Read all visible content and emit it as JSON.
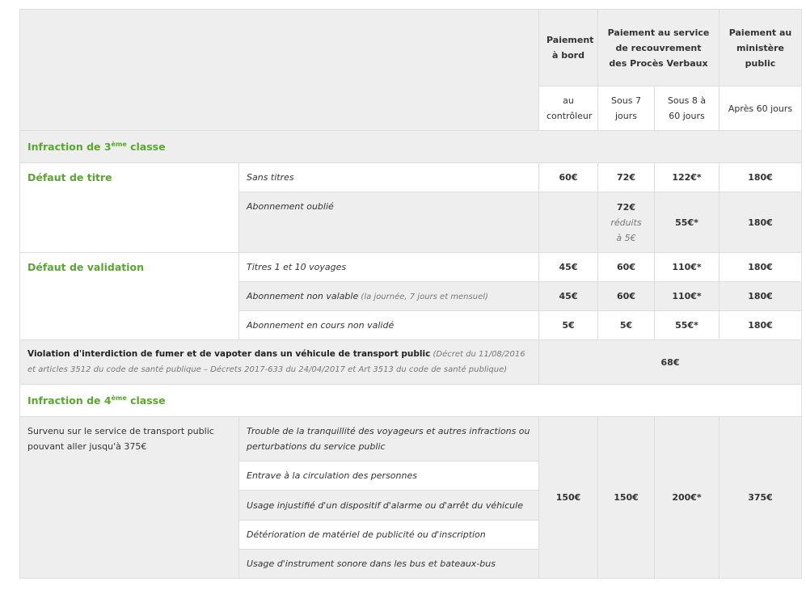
{
  "header": {
    "col_bord": "Paiement à bord",
    "col_service": "Paiement au service de recouvrement des Procès Verbaux",
    "col_ministere": "Paiement au ministère public",
    "sub_controleur": "au contrôleur",
    "sub_7": "Sous 7 jours",
    "sub_8_60": "Sous 8 à 60 jours",
    "sub_apres": "Après 60 jours"
  },
  "class3": {
    "prefix": "Infraction de 3",
    "sup": "ème",
    "suffix": " classe"
  },
  "titre": {
    "label": "Défaut de titre",
    "rows": [
      {
        "desc": "Sans titres",
        "bord": "60€",
        "s7": "72€",
        "s60": "122€*",
        "apres": "180€"
      },
      {
        "desc": "Abonnement oublié",
        "bord": "",
        "s7": "72€",
        "s7_note1": "réduits",
        "s7_note2": "à 5€",
        "s60": "55€*",
        "apres": "180€"
      }
    ]
  },
  "validation": {
    "label": "Défaut de validation",
    "rows": [
      {
        "desc": "Titres 1 et 10 voyages",
        "note": "",
        "bord": "45€",
        "s7": "60€",
        "s60": "110€*",
        "apres": "180€"
      },
      {
        "desc": "Abonnement non valable",
        "note": " (la journée, 7 jours et mensuel)",
        "bord": "45€",
        "s7": "60€",
        "s60": "110€*",
        "apres": "180€"
      },
      {
        "desc": "Abonnement en cours non validé",
        "note": "",
        "bord": "5€",
        "s7": "5€",
        "s60": "55€*",
        "apres": "180€"
      }
    ]
  },
  "fumer": {
    "label": "Violation d'interdiction de fumer et de vapoter dans un véhicule de transport public",
    "note": " (Décret du 11/08/2016 et articles 3512 du code de santé publique – Décrets 2017-633 du 24/04/2017 et Art 3513 du code de santé publique)",
    "amount": "68€"
  },
  "class4": {
    "prefix": "Infraction de 4",
    "sup": "ème",
    "suffix": " classe"
  },
  "service": {
    "label": "Survenu sur le service de transport public pouvant aller jusqu'à 375€",
    "rows": [
      "Trouble de la tranquillité des voyageurs et autres infractions ou perturbations du service public",
      "Entrave à la circulation des personnes",
      "Usage injustifié d'un dispositif d'alarme ou d'arrêt du véhicule",
      "Détérioration de matériel de publicité ou d'inscription",
      "Usage d'instrument sonore dans les bus et bateaux-bus"
    ],
    "bord": "150€",
    "s7": "150€",
    "s60": "200€*",
    "apres": "375€"
  }
}
